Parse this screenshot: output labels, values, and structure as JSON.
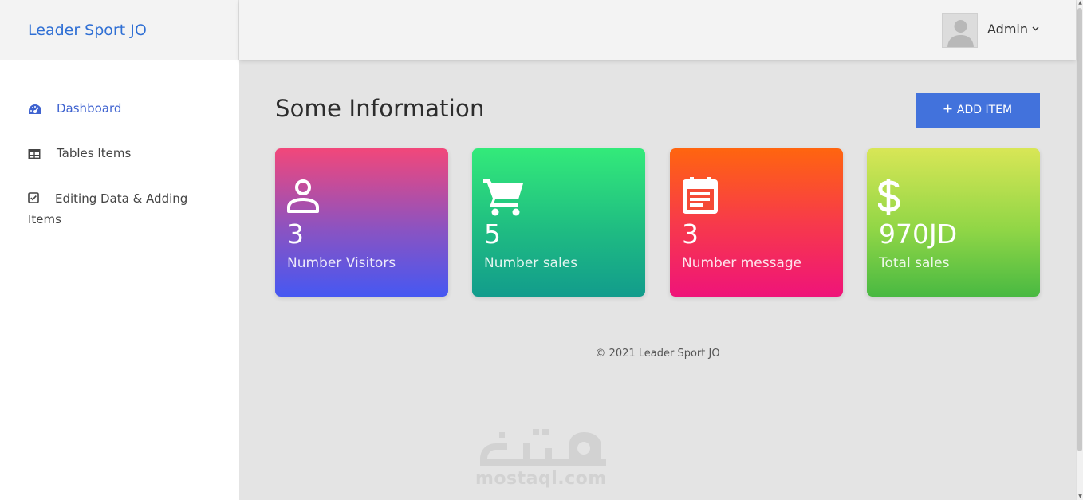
{
  "brand": {
    "name": "Leader Sport JO"
  },
  "header": {
    "user_name": "Admin",
    "avatar_icon": "user-avatar-icon",
    "chevron_icon": "chevron-down-icon"
  },
  "sidebar": {
    "items": [
      {
        "label": "Dashboard",
        "icon": "dashboard-gauge-icon",
        "active": true
      },
      {
        "label": "Tables Items",
        "icon": "table-icon",
        "active": false
      },
      {
        "label": "Editing Data & Adding Items",
        "icon": "checkbox-icon",
        "active": false
      }
    ]
  },
  "main": {
    "title": "Some Information",
    "add_button_label": "ADD ITEM",
    "add_button_icon": "plus-icon",
    "cards": [
      {
        "value": "3",
        "label": "Number Visitors",
        "icon": "person-icon"
      },
      {
        "value": "5",
        "label": "Number sales",
        "icon": "cart-icon"
      },
      {
        "value": "3",
        "label": "Number message",
        "icon": "calendar-note-icon"
      },
      {
        "value": "970JD",
        "label": "Total sales",
        "icon": "dollar-icon"
      }
    ]
  },
  "footer": {
    "text": "© 2021 Leader Sport JO"
  },
  "watermark": {
    "text": "mostaql.com"
  },
  "colors": {
    "brand": "#2f6fd4",
    "accent": "#4272dc",
    "active_nav": "#3f63d0"
  }
}
